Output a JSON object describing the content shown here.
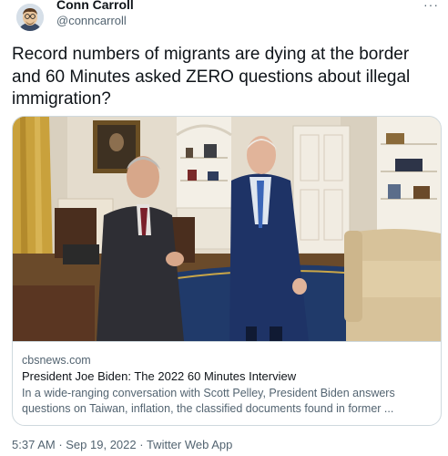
{
  "author": {
    "display_name": "Conn Carroll",
    "handle": "@conncarroll",
    "avatar_icon": "cartoon-avatar-icon"
  },
  "menu": {
    "more_label": "···",
    "icon": "more-options-icon"
  },
  "tweet": {
    "text": "Record numbers of migrants are dying at the border and 60 Minutes asked ZERO questions about illegal immigration?"
  },
  "link_card": {
    "domain": "cbsnews.com",
    "title": "President Joe Biden: The 2022 60 Minutes Interview",
    "description": "In a wide-ranging conversation with Scott Pelley, President Biden answers questions on Taiwan, inflation, the classified documents found in former ..."
  },
  "meta": {
    "time": "5:37 AM",
    "separator": " · ",
    "date": "Sep 19, 2022",
    "source": "Twitter Web App"
  },
  "colors": {
    "text_primary": "#0f1419",
    "text_secondary": "#536471",
    "border": "#cfd9de",
    "background": "#ffffff"
  }
}
